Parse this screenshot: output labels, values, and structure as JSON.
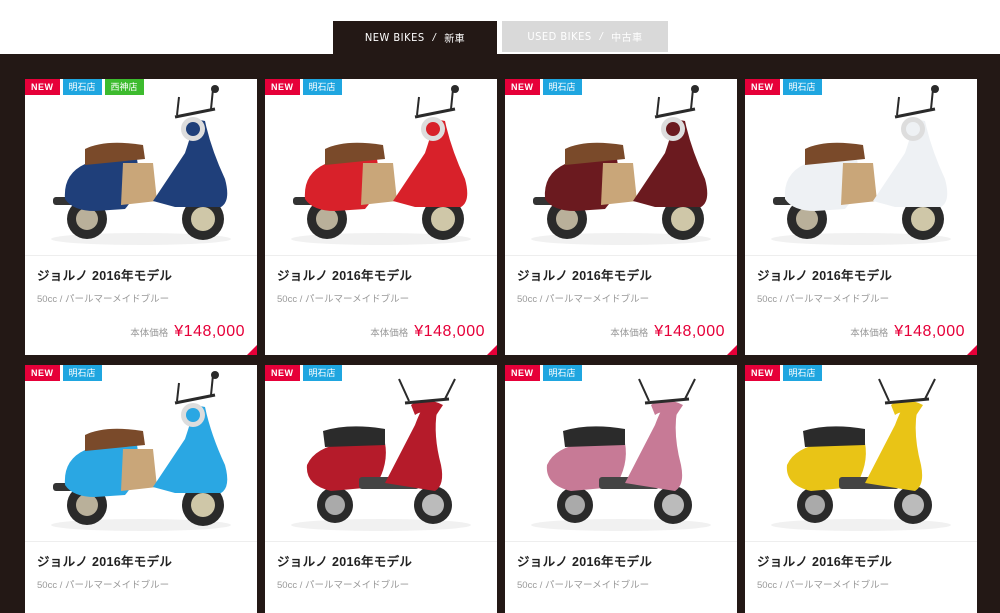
{
  "tabs": {
    "new": {
      "en": "NEW BIKES",
      "sep": "/",
      "ja": "新車"
    },
    "used": {
      "en": "USED BIKES",
      "sep": "/",
      "ja": "中古車"
    }
  },
  "cards": [
    {
      "badges": [
        "NEW",
        "明石店",
        "西神店"
      ],
      "name": "ジョルノ 2016年モデル",
      "spec": "50cc / パールマーメイドブルー",
      "price_label": "本体価格",
      "price": "¥148,000",
      "color": "#1f3f7a",
      "type": "giorno"
    },
    {
      "badges": [
        "NEW",
        "明石店"
      ],
      "name": "ジョルノ 2016年モデル",
      "spec": "50cc / パールマーメイドブルー",
      "price_label": "本体価格",
      "price": "¥148,000",
      "color": "#d8212a",
      "type": "giorno"
    },
    {
      "badges": [
        "NEW",
        "明石店"
      ],
      "name": "ジョルノ 2016年モデル",
      "spec": "50cc / パールマーメイドブルー",
      "price_label": "本体価格",
      "price": "¥148,000",
      "color": "#6b1a1f",
      "type": "giorno"
    },
    {
      "badges": [
        "NEW",
        "明石店"
      ],
      "name": "ジョルノ 2016年モデル",
      "spec": "50cc / パールマーメイドブルー",
      "price_label": "本体価格",
      "price": "¥148,000",
      "color": "#eef1f4",
      "type": "giorno"
    },
    {
      "badges": [
        "NEW",
        "明石店"
      ],
      "name": "ジョルノ 2016年モデル",
      "spec": "50cc / パールマーメイドブルー",
      "price_label": "",
      "price": "",
      "color": "#2aa7e3",
      "type": "giorno"
    },
    {
      "badges": [
        "NEW",
        "明石店"
      ],
      "name": "ジョルノ 2016年モデル",
      "spec": "50cc / パールマーメイドブルー",
      "price_label": "",
      "price": "",
      "color": "#b51b2a",
      "type": "tact"
    },
    {
      "badges": [
        "NEW",
        "明石店"
      ],
      "name": "ジョルノ 2016年モデル",
      "spec": "50cc / パールマーメイドブルー",
      "price_label": "",
      "price": "",
      "color": "#c77a96",
      "type": "tact"
    },
    {
      "badges": [
        "NEW",
        "明石店"
      ],
      "name": "ジョルノ 2016年モデル",
      "spec": "50cc / パールマーメイドブルー",
      "price_label": "",
      "price": "",
      "color": "#e9c416",
      "type": "tact"
    }
  ],
  "icons": {
    "corner": "corner-triangle-icon",
    "bike": "scooter-icon"
  },
  "colors": {
    "accent": "#e60039",
    "store_blue": "#1fa6e0",
    "store_green": "#3dbb2e",
    "dark": "#231815"
  }
}
